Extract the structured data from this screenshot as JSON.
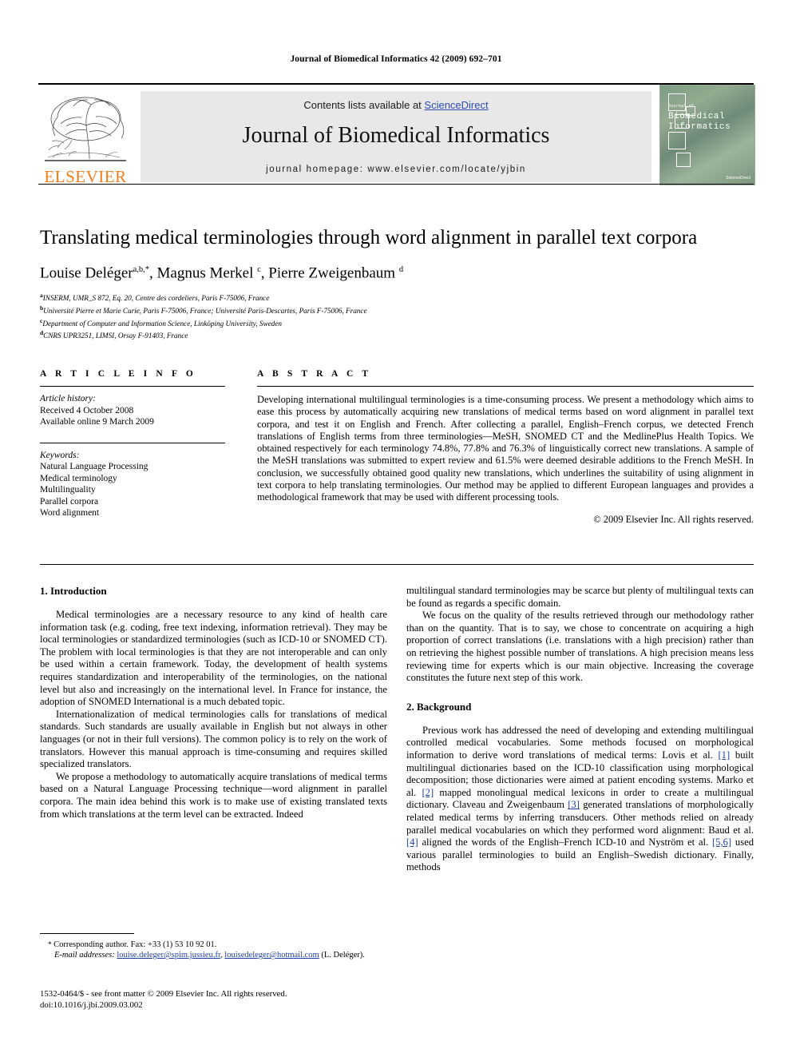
{
  "running_head": "Journal of Biomedical Informatics 42 (2009) 692–701",
  "masthead": {
    "contents_prefix": "Contents lists available at ",
    "sciencedirect": "ScienceDirect",
    "journal_title": "Journal of Biomedical Informatics",
    "homepage": "journal homepage: www.elsevier.com/locate/yjbin",
    "publisher_wordmark": "ELSEVIER",
    "cover": {
      "line_small": "Journal of",
      "line1": "Biomedical",
      "line2": "Informatics",
      "badge": "ScienceDirect"
    }
  },
  "title": "Translating medical terminologies through word alignment in parallel text corpora",
  "authors_html": "Louise Deléger<sup>a,b,</sup><sup>*</sup>, Magnus Merkel <sup>c</sup>, Pierre Zweigenbaum <sup>d</sup>",
  "affiliations": [
    {
      "marker": "a",
      "text": "INSERM, UMR_S 872, Eq. 20, Centre des cordeliers, Paris F-75006, France"
    },
    {
      "marker": "b",
      "text": "Université Pierre et Marie Curie, Paris F-75006, France; Université Paris-Descartes, Paris F-75006, France"
    },
    {
      "marker": "c",
      "text": "Department of Computer and Information Science, Linköping University, Sweden"
    },
    {
      "marker": "d",
      "text": "CNRS UPR3251, LIMSI, Orsay F-91403, France"
    }
  ],
  "article_info": {
    "heading": "A R T I C L E  I N F O",
    "history_label": "Article history:",
    "history": [
      "Received 4 October 2008",
      "Available online 9 March 2009"
    ],
    "keywords_label": "Keywords:",
    "keywords": [
      "Natural Language Processing",
      "Medical terminology",
      "Multilinguality",
      "Parallel corpora",
      "Word alignment"
    ]
  },
  "abstract": {
    "heading": "A B S T R A C T",
    "body": "Developing international multilingual terminologies is a time-consuming process. We present a methodology which aims to ease this process by automatically acquiring new translations of medical terms based on word alignment in parallel text corpora, and test it on English and French. After collecting a parallel, English–French corpus, we detected French translations of English terms from three terminologies—MeSH, SNOMED CT and the MedlinePlus Health Topics. We obtained respectively for each terminology 74.8%, 77.8% and 76.3% of linguistically correct new translations. A sample of the MeSH translations was submitted to expert review and 61.5% were deemed desirable additions to the French MeSH. In conclusion, we successfully obtained good quality new translations, which underlines the suitability of using alignment in text corpora to help translating terminologies. Our method may be applied to different European languages and provides a methodological framework that may be used with different processing tools.",
    "copyright": "© 2009 Elsevier Inc. All rights reserved."
  },
  "sections": {
    "introduction": {
      "heading": "1. Introduction",
      "paragraphs": [
        "Medical terminologies are a necessary resource to any kind of health care information task (e.g. coding, free text indexing, information retrieval). They may be local terminologies or standardized terminologies (such as ICD-10 or SNOMED CT). The problem with local terminologies is that they are not interoperable and can only be used within a certain framework. Today, the development of health systems requires standardization and interoperability of the terminologies, on the national level but also and increasingly on the international level. In France for instance, the adoption of SNOMED International is a much debated topic.",
        "Internationalization of medical terminologies calls for translations of medical standards. Such standards are usually available in English but not always in other languages (or not in their full versions). The common policy is to rely on the work of translators. However this manual approach is time-consuming and requires skilled specialized translators.",
        "We propose a methodology to automatically acquire translations of medical terms based on a Natural Language Processing technique—word alignment in parallel corpora. The main idea behind this work is to make use of existing translated texts from which translations at the term level can be extracted. Indeed"
      ],
      "continuation": [
        "multilingual standard terminologies may be scarce but plenty of multilingual texts can be found as regards a specific domain.",
        "We focus on the quality of the results retrieved through our methodology rather than on the quantity. That is to say, we chose to concentrate on acquiring a high proportion of correct translations (i.e. translations with a high precision) rather than on retrieving the highest possible number of translations. A high precision means less reviewing time for experts which is our main objective. Increasing the coverage constitutes the future next step of this work."
      ]
    },
    "background": {
      "heading": "2. Background",
      "paragraph_parts": [
        "Previous work has addressed the need of developing and extending multilingual controlled medical vocabularies. Some methods focused on morphological information to derive word translations of medical terms: Lovis et al. ",
        " built multilingual dictionaries based on the ICD-10 classification using morphological decomposition; those dictionaries were aimed at patient encoding systems. Marko et al. ",
        " mapped monolingual medical lexicons in order to create a multilingual dictionary. Claveau and Zweigenbaum ",
        " generated translations of morphologically related medical terms by inferring transducers. Other methods relied on already parallel medical vocabularies on which they performed word alignment: Baud et al. ",
        " aligned the words of the English–French ICD-10 and Nyström et al. ",
        " used various parallel terminologies to build an English–Swedish dictionary. Finally, methods"
      ],
      "refs": [
        "[1]",
        "[2]",
        "[3]",
        "[4]",
        "[5,6]"
      ]
    }
  },
  "footnote": {
    "corresponding": "Corresponding author. Fax: +33 (1) 53 10 92 01.",
    "email_label": "E-mail addresses:",
    "email1": "louise.deleger@spim.jussieu.fr",
    "email2": "louisedeleger@hotmail.com",
    "email_owner": "(L. Deléger)."
  },
  "imprint": {
    "line1": "1532-0464/$ - see front matter © 2009 Elsevier Inc. All rights reserved.",
    "line2": "doi:10.1016/j.jbi.2009.03.002"
  },
  "colors": {
    "link": "#1c3fa8",
    "sciencedirect": "#2b49b5",
    "elsevier_orange": "#F07D18",
    "band_gray": "#e8e8e8"
  }
}
